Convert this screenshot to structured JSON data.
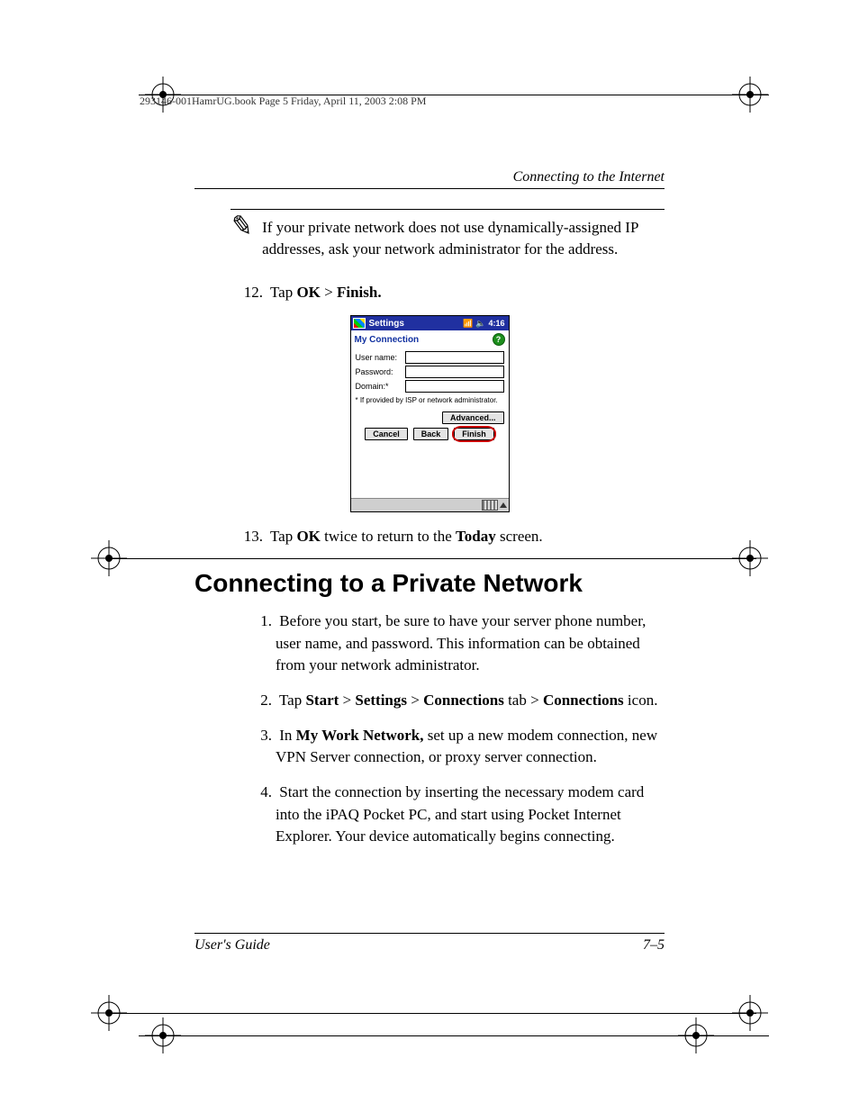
{
  "meta_header": "293146-001HamrUG.book  Page 5  Friday, April 11, 2003  2:08 PM",
  "running_head": "Connecting to the Internet",
  "note_text": "If your private network does not use dynamically-assigned IP addresses, ask your network administrator for the address.",
  "step12": {
    "num": "12.",
    "pre": "Tap ",
    "b1": "OK",
    "mid": " > ",
    "b2": "Finish."
  },
  "shot": {
    "titlebar": "Settings",
    "time": "4:16",
    "connection_title": "My Connection",
    "label_user": "User name:",
    "label_pass": "Password:",
    "label_domain": "Domain:*",
    "fineprint": "* If provided by ISP or network administrator.",
    "btn_advanced": "Advanced...",
    "btn_cancel": "Cancel",
    "btn_back": "Back",
    "btn_finish": "Finish"
  },
  "step13": {
    "num": "13.",
    "pre": "Tap ",
    "b1": "OK",
    "mid": " twice to return to the ",
    "b2": "Today",
    "post": " screen."
  },
  "section_heading": "Connecting to a Private Network",
  "steps": {
    "s1": {
      "num": "1.",
      "text": "Before you start, be sure to have your server phone number, user name, and password. This information can be obtained from your network administrator."
    },
    "s2": {
      "num": "2.",
      "p0": "Tap ",
      "b1": "Start",
      "g1": " > ",
      "b2": "Settings",
      "g2": " > ",
      "b3": "Connections",
      "g3": " tab > ",
      "b4": "Connections",
      "g4": " icon."
    },
    "s3": {
      "num": "3.",
      "pre": "In ",
      "b1": "My Work Network,",
      "post": " set up a new modem connection, new VPN Server connection, or proxy server connection."
    },
    "s4": {
      "num": "4.",
      "text": "Start the connection by inserting the necessary modem card into the iPAQ Pocket PC, and start using Pocket Internet Explorer. Your device automatically begins connecting."
    }
  },
  "footer_left": "User's Guide",
  "footer_right": "7–5"
}
